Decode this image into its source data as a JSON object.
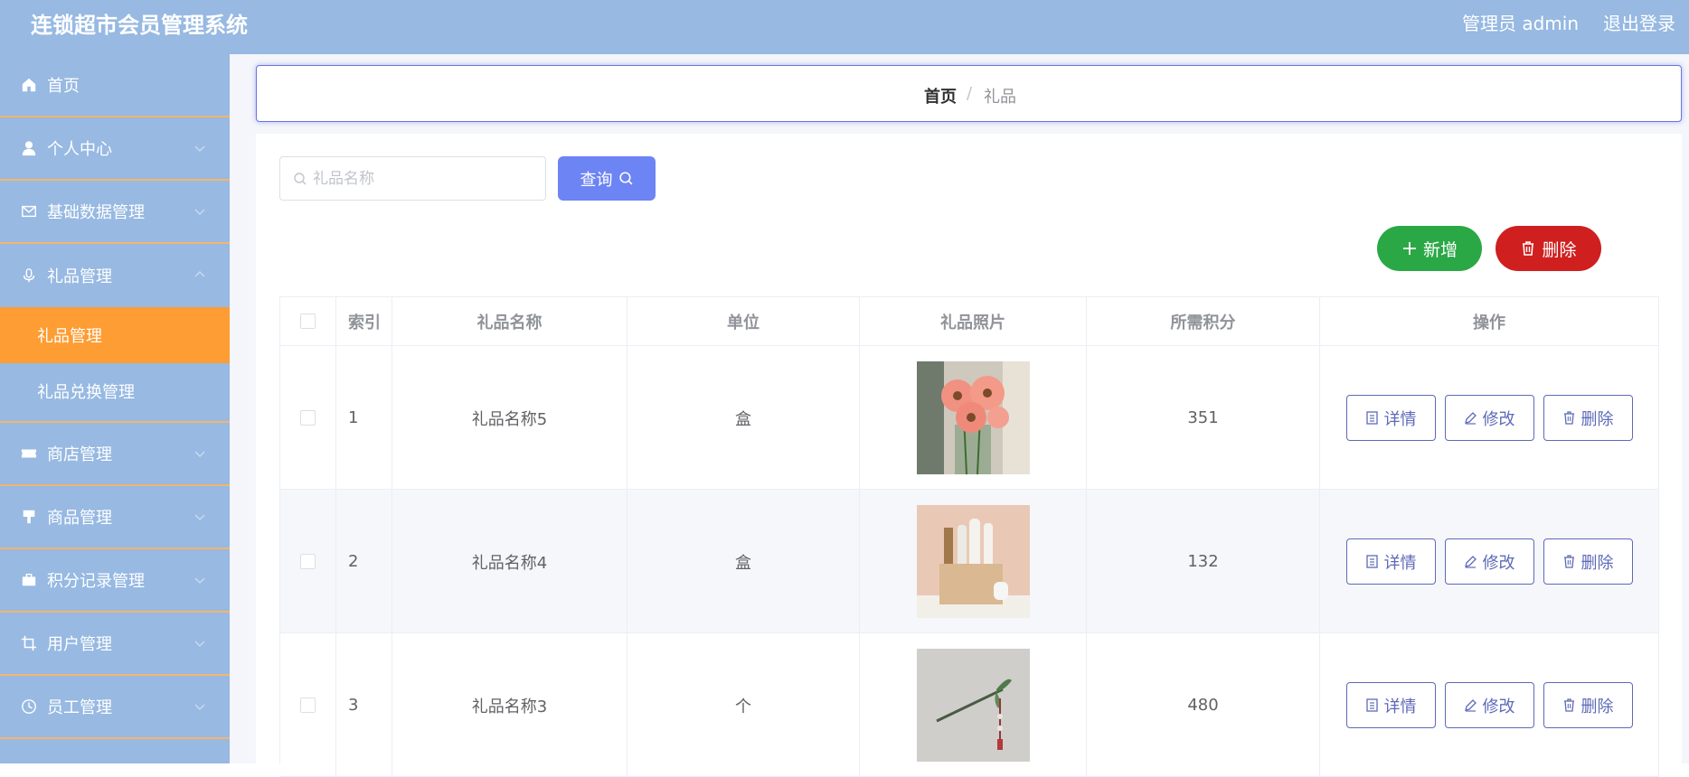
{
  "header": {
    "title": "连锁超市会员管理系统",
    "user": "管理员 admin",
    "logout": "退出登录"
  },
  "sidebar": {
    "items": [
      {
        "label": "首页",
        "icon": "home-icon"
      },
      {
        "label": "个人中心",
        "icon": "user-icon"
      },
      {
        "label": "基础数据管理",
        "icon": "mail-icon"
      },
      {
        "label": "礼品管理",
        "icon": "microphone-icon",
        "expanded": true
      },
      {
        "label": "商店管理",
        "icon": "ticket-icon"
      },
      {
        "label": "商品管理",
        "icon": "brush-icon"
      },
      {
        "label": "积分记录管理",
        "icon": "briefcase-icon"
      },
      {
        "label": "用户管理",
        "icon": "crop-icon"
      },
      {
        "label": "员工管理",
        "icon": "clock-icon"
      }
    ],
    "sub_items": [
      {
        "label": "礼品管理",
        "active": true
      },
      {
        "label": "礼品兑换管理",
        "active": false
      }
    ]
  },
  "breadcrumb": {
    "home": "首页",
    "separator": "/",
    "current": "礼品"
  },
  "search": {
    "placeholder": "礼品名称",
    "button": "查询"
  },
  "actions": {
    "add": "新增",
    "delete": "删除"
  },
  "table": {
    "headers": [
      "索引",
      "礼品名称",
      "单位",
      "礼品照片",
      "所需积分",
      "操作"
    ],
    "rows": [
      {
        "index": "1",
        "name": "礼品名称5",
        "unit": "盒",
        "photo": "pink-gerbera-flowers",
        "points": "351"
      },
      {
        "index": "2",
        "name": "礼品名称4",
        "unit": "盒",
        "photo": "gift-box-with-items",
        "points": "132"
      },
      {
        "index": "3",
        "name": "礼品名称3",
        "unit": "个",
        "photo": "hair-pin-ornament",
        "points": "480"
      }
    ],
    "row_actions": {
      "detail": "详情",
      "edit": "修改",
      "delete": "删除"
    }
  },
  "colors": {
    "header_bg": "#97b9e2",
    "active_menu": "#fe9d33",
    "query_button": "#6d84f4",
    "add_button": "#2aa845",
    "delete_button": "#d01f1f",
    "row_action": "#5d6ab8"
  }
}
